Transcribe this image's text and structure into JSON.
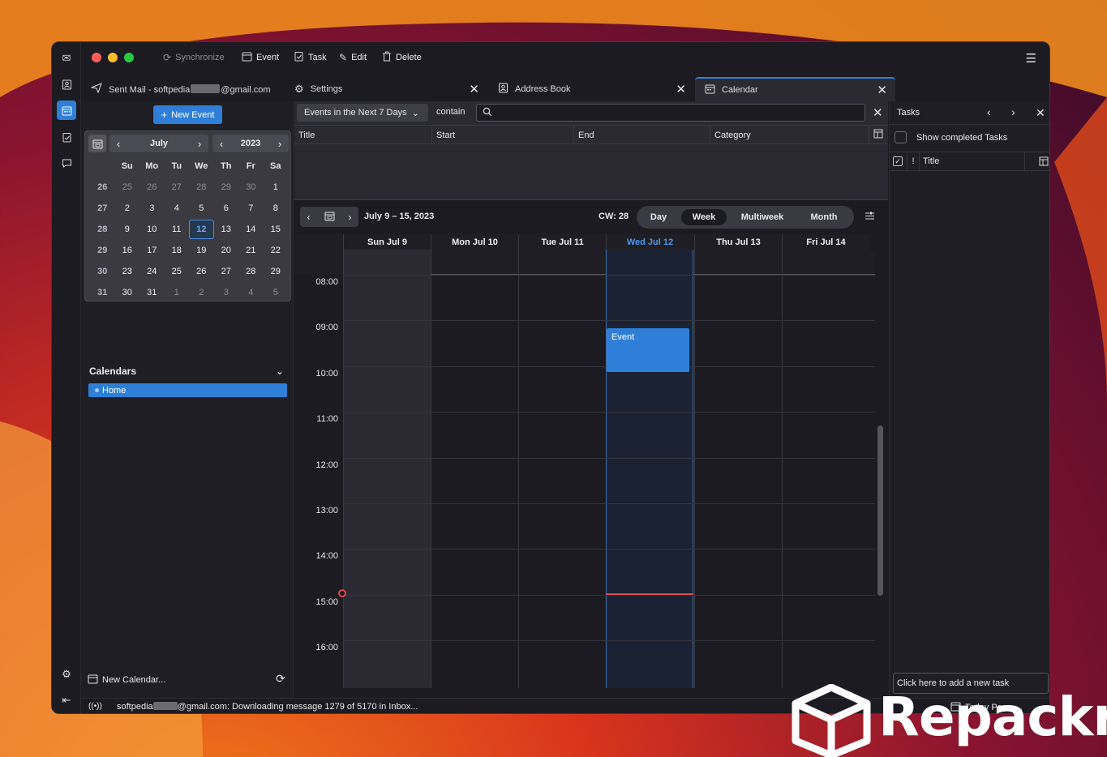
{
  "toolbar": {
    "synchronize": "Synchronize",
    "event": "Event",
    "task": "Task",
    "edit": "Edit",
    "delete": "Delete"
  },
  "tabs": [
    {
      "label": "Sent Mail - softpedia",
      "label_suffix": "@gmail.com"
    },
    {
      "label": "Settings"
    },
    {
      "label": "Address Book"
    },
    {
      "label": "Calendar"
    }
  ],
  "leftpane": {
    "new_event": "New Event",
    "month": "July",
    "year": "2023",
    "weekdays": [
      "Su",
      "Mo",
      "Tu",
      "We",
      "Th",
      "Fr",
      "Sa"
    ],
    "weeks": [
      {
        "wk": "26",
        "days": [
          "25",
          "26",
          "27",
          "28",
          "29",
          "30",
          "1"
        ],
        "dim": [
          true,
          true,
          true,
          true,
          true,
          true,
          false
        ]
      },
      {
        "wk": "27",
        "days": [
          "2",
          "3",
          "4",
          "5",
          "6",
          "7",
          "8"
        ],
        "dim": [
          false,
          false,
          false,
          false,
          false,
          false,
          false
        ]
      },
      {
        "wk": "28",
        "days": [
          "9",
          "10",
          "11",
          "12",
          "13",
          "14",
          "15"
        ],
        "dim": [
          false,
          false,
          false,
          false,
          false,
          false,
          false
        ]
      },
      {
        "wk": "29",
        "days": [
          "16",
          "17",
          "18",
          "19",
          "20",
          "21",
          "22"
        ],
        "dim": [
          false,
          false,
          false,
          false,
          false,
          false,
          false
        ]
      },
      {
        "wk": "30",
        "days": [
          "23",
          "24",
          "25",
          "26",
          "27",
          "28",
          "29"
        ],
        "dim": [
          false,
          false,
          false,
          false,
          false,
          false,
          false
        ]
      },
      {
        "wk": "31",
        "days": [
          "30",
          "31",
          "1",
          "2",
          "3",
          "4",
          "5"
        ],
        "dim": [
          false,
          false,
          true,
          true,
          true,
          true,
          true
        ]
      }
    ],
    "today": "12",
    "calendars_heading": "Calendars",
    "calendar_home": "Home",
    "new_calendar": "New Calendar..."
  },
  "filter": {
    "range": "Events in the Next 7 Days",
    "mode": "contain",
    "search_value": ""
  },
  "list_columns": [
    "Title",
    "Start",
    "End",
    "Category"
  ],
  "view": {
    "date_range": "July 9 – 15, 2023",
    "cw": "CW: 28",
    "modes": [
      "Day",
      "Week",
      "Multiweek",
      "Month"
    ],
    "active_mode": "Week",
    "days": [
      "Sun Jul 9",
      "Mon Jul 10",
      "Tue Jul 11",
      "Wed Jul 12",
      "Thu Jul 13",
      "Fri Jul 14"
    ],
    "today_index": 3,
    "hours": [
      "08:00",
      "09:00",
      "10:00",
      "11:00",
      "12:00",
      "13:00",
      "14:00",
      "15:00",
      "16:00"
    ],
    "event_title": "Event"
  },
  "tasks": {
    "title": "Tasks",
    "show_completed": "Show completed Tasks",
    "column_flag": "!",
    "column_title": "Title",
    "new_task_placeholder": "Click here to add a new task",
    "today_pane": "Today Pane"
  },
  "status": {
    "prefix": "softpedia",
    "suffix": "@gmail.com: Downloading message 1279 of 5170 in Inbox..."
  },
  "watermark": "Repackra",
  "colors": {
    "accent": "#2f7fd8",
    "window_bg": "#1c1b22",
    "today_text": "#4a9af2",
    "now_line": "#e04848"
  }
}
